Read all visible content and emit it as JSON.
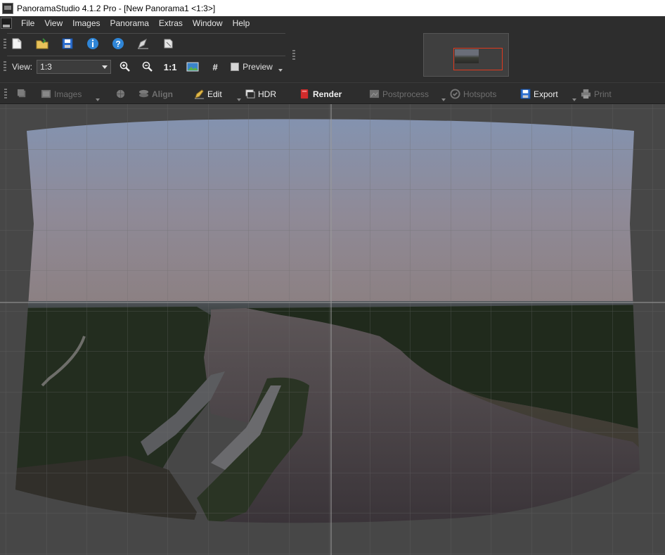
{
  "window": {
    "title": "PanoramaStudio 4.1.2 Pro - [New Panorama1 <1:3>]"
  },
  "menu": {
    "items": [
      "File",
      "View",
      "Images",
      "Panorama",
      "Extras",
      "Window",
      "Help"
    ]
  },
  "toolbar": {
    "icons": [
      "new-document-icon",
      "open-folder-icon",
      "save-icon",
      "info-icon",
      "help-icon",
      "edit-icon",
      "copy-icon"
    ],
    "view_label": "View:",
    "view_value": "1:3",
    "zoom_icons": [
      "zoom-in-icon",
      "zoom-out-icon",
      "zoom-1to1-icon",
      "fit-image-icon",
      "grid-icon"
    ],
    "zoom_1to1_glyph": "1:1",
    "grid_glyph": "#",
    "preview_label": "Preview"
  },
  "workflow": {
    "images_label": "Images",
    "align_label": "Align",
    "edit_label": "Edit",
    "hdr_label": "HDR",
    "render_label": "Render",
    "postprocess_label": "Postprocess",
    "hotspots_label": "Hotspots",
    "export_label": "Export",
    "print_label": "Print"
  },
  "colors": {
    "accent_render": "#d12b2b",
    "navigator_frame": "#e03a1e",
    "sky_top": "#8294b3",
    "sky_horizon": "#8c8082",
    "water": "#3f3a3f",
    "forest": "#232d1f"
  }
}
